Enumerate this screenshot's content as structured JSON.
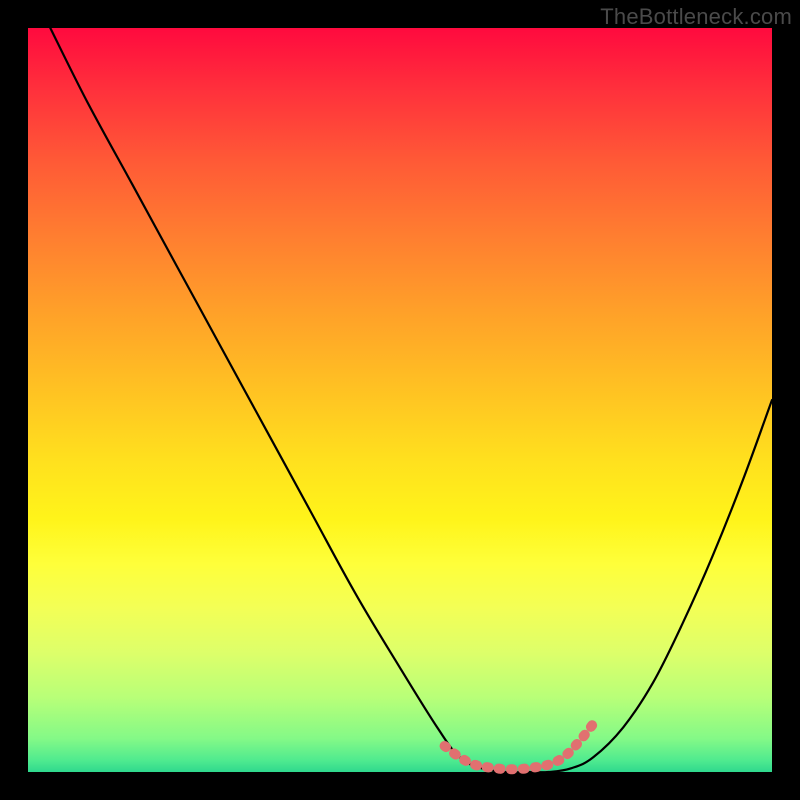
{
  "watermark": "TheBottleneck.com",
  "chart_data": {
    "type": "line",
    "title": "",
    "xlabel": "",
    "ylabel": "",
    "xlim": [
      0,
      100
    ],
    "ylim": [
      0,
      100
    ],
    "series": [
      {
        "name": "bottleneck-curve",
        "x": [
          3,
          8,
          14,
          20,
          26,
          32,
          38,
          44,
          50,
          55,
          58,
          61,
          64,
          67,
          70,
          73,
          76,
          80,
          84,
          88,
          92,
          96,
          100
        ],
        "y": [
          100,
          90,
          79,
          68,
          57,
          46,
          35,
          24,
          14,
          6,
          2,
          0.5,
          0,
          0,
          0,
          0.5,
          2,
          6,
          12,
          20,
          29,
          39,
          50
        ]
      },
      {
        "name": "flat-highlight",
        "x": [
          56,
          58,
          60,
          62,
          64,
          66,
          68,
          70,
          72,
          74,
          76
        ],
        "y": [
          3.5,
          2,
          1,
          0.6,
          0.4,
          0.4,
          0.6,
          1,
          2,
          4,
          6.5
        ]
      }
    ],
    "colors": {
      "curve": "#000000",
      "highlight": "#e17070"
    }
  }
}
